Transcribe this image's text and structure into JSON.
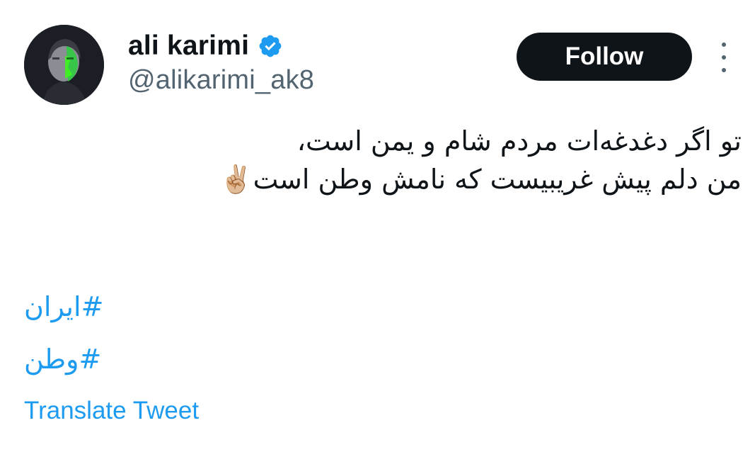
{
  "author": {
    "display_name": "ali karimi",
    "handle": "@alikarimi_ak8",
    "verified": true,
    "avatar_icon": "profile-photo"
  },
  "actions": {
    "follow_label": "Follow",
    "more_icon": "more-vertical-icon"
  },
  "tweet": {
    "lines": [
      "تو اگر دغدغه‌ات مردم شام و یمن است،",
      "من دلم پیش غریبیست که نامش وطن است"
    ],
    "emoji": "✌🏼",
    "hashtags": [
      "#ایران",
      "#وطن"
    ],
    "translate_label": "Translate Tweet"
  },
  "colors": {
    "link": "#1d9bf0",
    "text": "#0f1419",
    "secondary": "#536471",
    "button": "#0f1419"
  }
}
